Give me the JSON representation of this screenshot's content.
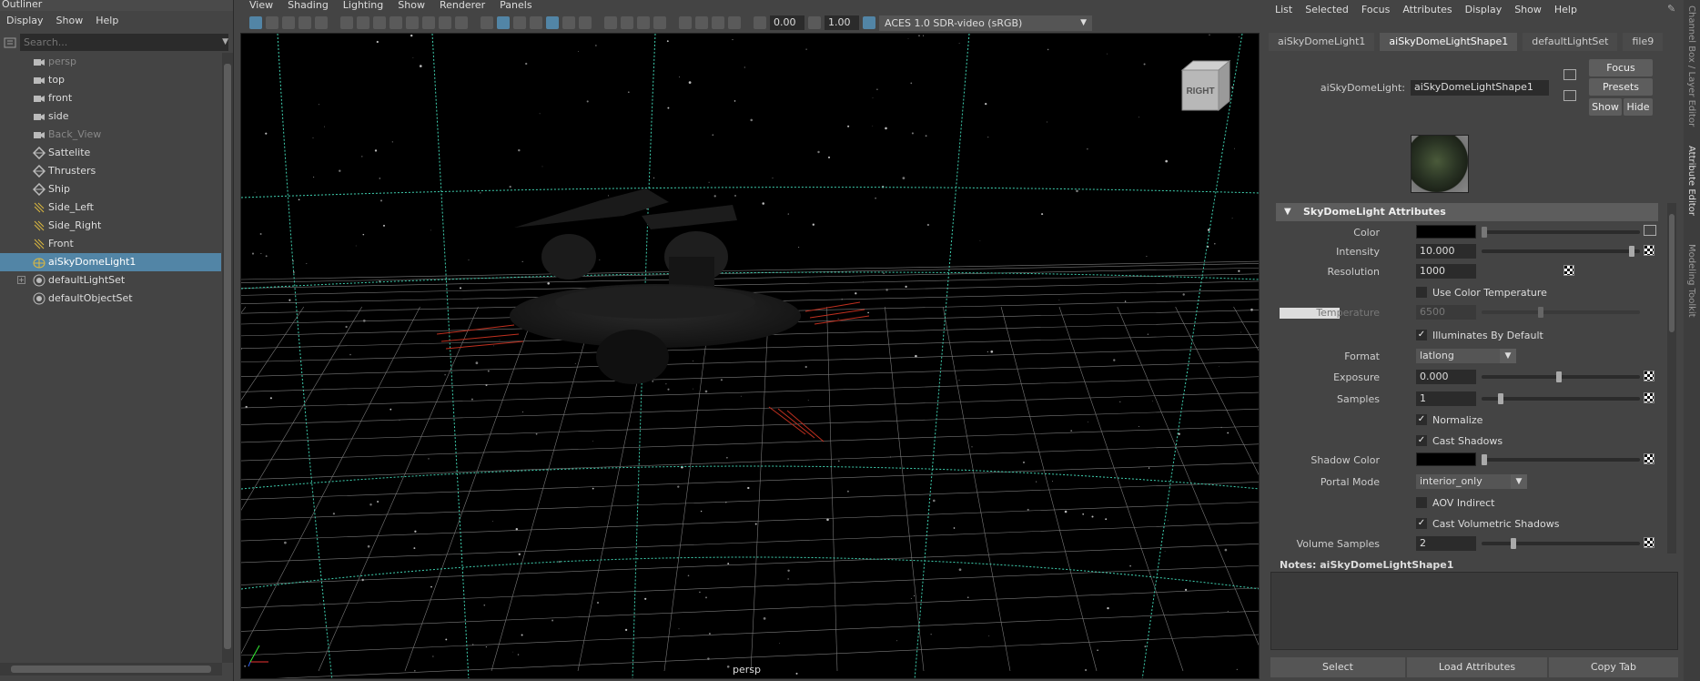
{
  "outliner": {
    "title": "Outliner",
    "menu": [
      "Display",
      "Show",
      "Help"
    ],
    "search_placeholder": "Search...",
    "items": [
      {
        "label": "persp",
        "icon": "camera-icon",
        "dim": true
      },
      {
        "label": "top",
        "icon": "camera-icon",
        "dim": false
      },
      {
        "label": "front",
        "icon": "camera-icon",
        "dim": false
      },
      {
        "label": "side",
        "icon": "camera-icon",
        "dim": false
      },
      {
        "label": "Back_View",
        "icon": "camera-icon",
        "dim": true
      },
      {
        "label": "Sattelite",
        "icon": "transform-icon",
        "dim": false
      },
      {
        "label": "Thrusters",
        "icon": "transform-icon",
        "dim": false
      },
      {
        "label": "Ship",
        "icon": "transform-icon",
        "dim": false
      },
      {
        "label": "Side_Left",
        "icon": "light-icon",
        "dim": false
      },
      {
        "label": "Side_Right",
        "icon": "light-icon",
        "dim": false
      },
      {
        "label": "Front",
        "icon": "light-icon",
        "dim": false
      },
      {
        "label": "aiSkyDomeLight1",
        "icon": "skydome-icon",
        "selected": true
      },
      {
        "label": "defaultLightSet",
        "icon": "set-icon",
        "expandable": true
      },
      {
        "label": "defaultObjectSet",
        "icon": "set-icon"
      }
    ]
  },
  "viewport": {
    "menu": [
      "View",
      "Shading",
      "Lighting",
      "Show",
      "Renderer",
      "Panels"
    ],
    "num1": "0.00",
    "num2": "1.00",
    "colorspace": "ACES 1.0 SDR-video (sRGB)",
    "camera_label": "persp",
    "viewcube_label": "RIGHT",
    "grid_color": "#7a7a7a",
    "axis_color": "#3fd0b0"
  },
  "attribute_editor": {
    "menu": [
      "List",
      "Selected",
      "Focus",
      "Attributes",
      "Display",
      "Show",
      "Help"
    ],
    "tabs": [
      "aiSkyDomeLight1",
      "aiSkyDomeLightShape1",
      "defaultLightSet",
      "file9"
    ],
    "node_type_label": "aiSkyDomeLight:",
    "node_name": "aiSkyDomeLightShape1",
    "focus_label": "Focus",
    "presets_label": "Presets",
    "show_label": "Show",
    "hide_label": "Hide",
    "section_title": "SkyDomeLight Attributes",
    "color_label": "Color",
    "intensity_label": "Intensity",
    "intensity_value": "10.000",
    "resolution_label": "Resolution",
    "resolution_value": "1000",
    "use_color_temp_label": "Use Color Temperature",
    "temperature_label": "Temperature",
    "temperature_value": "6500",
    "illuminates_label": "Illuminates By Default",
    "format_label": "Format",
    "format_value": "latlong",
    "exposure_label": "Exposure",
    "exposure_value": "0.000",
    "samples_label": "Samples",
    "samples_value": "1",
    "normalize_label": "Normalize",
    "cast_shadows_label": "Cast Shadows",
    "shadow_color_label": "Shadow Color",
    "portal_mode_label": "Portal Mode",
    "portal_mode_value": "interior_only",
    "aov_indirect_label": "AOV Indirect",
    "cast_volumetric_label": "Cast Volumetric Shadows",
    "volume_samples_label": "Volume Samples",
    "volume_samples_value": "2",
    "notes_title": "Notes:  aiSkyDomeLightShape1",
    "select_label": "Select",
    "load_attributes_label": "Load Attributes",
    "copy_tab_label": "Copy Tab"
  },
  "side_tabs": [
    "Channel Box / Layer Editor",
    "Attribute Editor",
    "Modeling Toolkit"
  ]
}
